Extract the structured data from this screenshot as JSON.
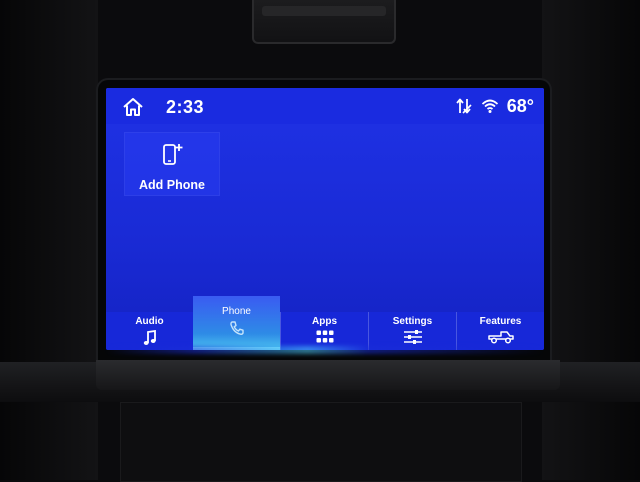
{
  "status": {
    "time": "2:33",
    "temperature": "68°"
  },
  "tiles": {
    "add_phone": {
      "label": "Add Phone",
      "icon": "phone-add-icon"
    }
  },
  "nav": {
    "active": "Phone",
    "tabs": [
      {
        "label": "Audio",
        "icon": "music-note-icon"
      },
      {
        "label": "Phone",
        "icon": "phone-handset-icon"
      },
      {
        "label": "Apps",
        "icon": "app-grid-icon"
      },
      {
        "label": "Settings",
        "icon": "sliders-icon"
      },
      {
        "label": "Features",
        "icon": "truck-icon"
      }
    ]
  },
  "colors": {
    "screen_blue": "#1a2be0",
    "active_tab_accent": "#4ec5f0"
  }
}
